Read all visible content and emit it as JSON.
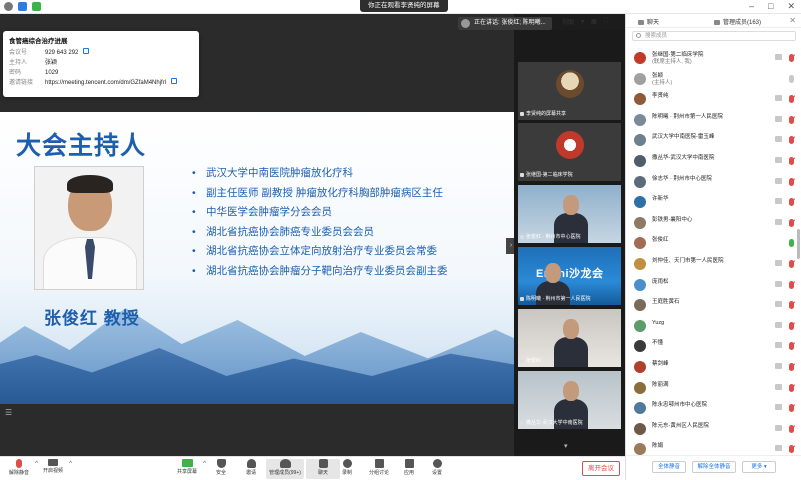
{
  "banner": "你正在观看李贤纯的屏幕",
  "speaker": "正在讲话: 张俊红; 陈明曦...",
  "view_label": "视图",
  "colors": {
    "blue": "#1d5fae",
    "red": "#e14b4b",
    "green": "#3bb54a"
  },
  "meeting_info": {
    "title": "食管癌综合治疗进展",
    "rows": [
      {
        "key": "会议号",
        "value": "929 643 292"
      },
      {
        "key": "主持人",
        "value": "张颖"
      },
      {
        "key": "密码",
        "value": "1029"
      },
      {
        "key": "邀请链接",
        "value": "https://meeting.tencent.com/dm/GZfaM4Nhjfrl"
      }
    ]
  },
  "slide": {
    "title": "大会主持人",
    "bullets": [
      "武汉大学中南医院肿瘤放化疗科",
      "副主任医师  副教授  肿瘤放化疗科胸部肿瘤病区主任",
      "中华医学会肿瘤学分会会员",
      "湖北省抗癌协会肺癌专业委员会会员",
      "湖北省抗癌协会立体定向放射治疗专业委员会常委",
      "湖北省抗癌协会肿瘤分子靶向治疗专业委员会副主委"
    ],
    "host_name": "张俊红    教授"
  },
  "tiles": [
    {
      "label": "李贤纯的屏幕共享"
    },
    {
      "label": "张继国-第二临床学院"
    },
    {
      "label": "张俊红 - 荆州市中心医院"
    },
    {
      "label": "陈明曦 · 荆州市第一人民医院",
      "banner": "Endni沙龙会"
    },
    {
      "label": "张俊红"
    },
    {
      "label": "撒丛华-武汉大学中南医院"
    }
  ],
  "panel": {
    "chat_tab": "聊天",
    "manage_tab": "管理成员(163)",
    "search_placeholder": "搜索成员",
    "participants": [
      {
        "name": "张继国-第二临床学院",
        "sub": "(联席主持人, 我)",
        "color": "#c0392b",
        "mic": "off"
      },
      {
        "name": "张颖",
        "sub": "(主持人)",
        "color": "#a0a0a0",
        "mic": "gray"
      },
      {
        "name": "李贤纯",
        "sub": "",
        "color": "#8e5a3a",
        "mic": "off"
      },
      {
        "name": "陈明曦 · 荆州市第一人民医院",
        "sub": "",
        "color": "#7a8a99",
        "mic": "off"
      },
      {
        "name": "武汉大学中南医院-雷玉峰",
        "sub": "",
        "color": "#6e7f8d",
        "mic": "off"
      },
      {
        "name": "撒丛华-武汉大学中南医院",
        "sub": "",
        "color": "#4e5d6a",
        "mic": "off"
      },
      {
        "name": "徐志华 · 荆州市中心医院",
        "sub": "",
        "color": "#5b6b7a",
        "mic": "off"
      },
      {
        "name": "许新华",
        "sub": "",
        "color": "#2f6fa8",
        "mic": "off"
      },
      {
        "name": "彭铁男-襄阳中心",
        "sub": "",
        "color": "#8c7a66",
        "mic": "off"
      },
      {
        "name": "张俊红",
        "sub": "",
        "color": "#a26b54",
        "mic": "green"
      },
      {
        "name": "刘仲佳、天门市第一人民医院",
        "sub": "",
        "color": "#c09040",
        "mic": "off"
      },
      {
        "name": "庞雨松",
        "sub": "",
        "color": "#4a8fc9",
        "mic": "off"
      },
      {
        "name": "王庭胜黄石",
        "sub": "",
        "color": "#7a6a5a",
        "mic": "off"
      },
      {
        "name": "Yuzg",
        "sub": "",
        "color": "#5d9c6a",
        "mic": "off"
      },
      {
        "name": "不懂",
        "sub": "",
        "color": "#3a3a3a",
        "mic": "off"
      },
      {
        "name": "蔡剑峰",
        "sub": "",
        "color": "#b04030",
        "mic": "off"
      },
      {
        "name": "陈丽满",
        "sub": "",
        "color": "#8a6d3b",
        "mic": "off"
      },
      {
        "name": "陈永忠鄂州市中心医院",
        "sub": "",
        "color": "#4f7a9c",
        "mic": "off"
      },
      {
        "name": "陈元东-黄州区人民医院",
        "sub": "",
        "color": "#6d5a4a",
        "mic": "off"
      },
      {
        "name": "陈娟",
        "sub": "",
        "color": "#9c7a5a",
        "mic": "off"
      }
    ],
    "footer": {
      "mute_all": "全体静音",
      "unmute_all": "解除全体静音",
      "more": "更多"
    }
  },
  "toolbar": {
    "items": [
      {
        "label": "解除静音"
      },
      {
        "label": "开启视频"
      },
      {
        "label": "共享屏幕"
      },
      {
        "label": "安全"
      },
      {
        "label": "邀请"
      },
      {
        "label": "管理成员(99+)"
      },
      {
        "label": "聊天"
      },
      {
        "label": "录制"
      },
      {
        "label": "分组讨论"
      },
      {
        "label": "应用"
      },
      {
        "label": "设置"
      }
    ],
    "leave": "离开会议"
  }
}
